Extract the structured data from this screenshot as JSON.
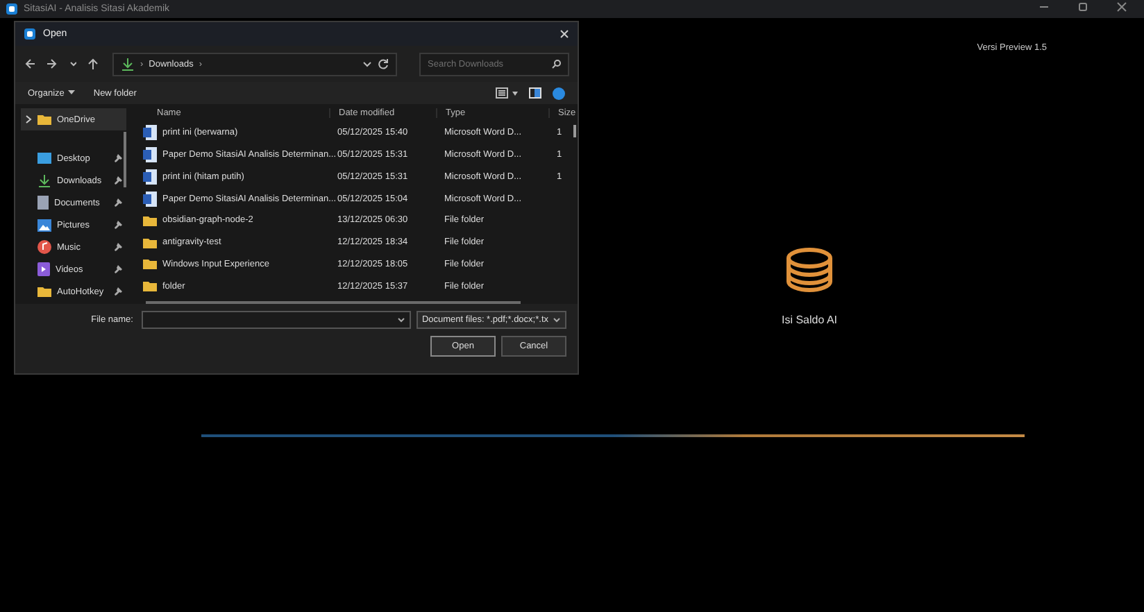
{
  "app": {
    "title": "SitasiAI - Analisis Sitasi Akademik",
    "version": "Versi Preview 1.5",
    "action_label": "Isi Saldo AI"
  },
  "dialog": {
    "title": "Open",
    "address": {
      "path": [
        "Downloads"
      ],
      "separator": "›"
    },
    "search": {
      "placeholder": "Search Downloads"
    },
    "toolbar": {
      "organize": "Organize",
      "new_folder": "New folder"
    },
    "sidebar": [
      {
        "label": "OneDrive",
        "kind": "folder",
        "selected": true,
        "pinned": false,
        "expandable": true
      },
      {
        "label": "Desktop",
        "kind": "desktop",
        "selected": false,
        "pinned": true,
        "expandable": false
      },
      {
        "label": "Downloads",
        "kind": "download",
        "selected": false,
        "pinned": true,
        "expandable": false
      },
      {
        "label": "Documents",
        "kind": "documents",
        "selected": false,
        "pinned": true,
        "expandable": false
      },
      {
        "label": "Pictures",
        "kind": "pictures",
        "selected": false,
        "pinned": true,
        "expandable": false
      },
      {
        "label": "Music",
        "kind": "music",
        "selected": false,
        "pinned": true,
        "expandable": false
      },
      {
        "label": "Videos",
        "kind": "videos",
        "selected": false,
        "pinned": true,
        "expandable": false
      },
      {
        "label": "AutoHotkey",
        "kind": "folder",
        "selected": false,
        "pinned": true,
        "expandable": false
      }
    ],
    "columns": [
      "Name",
      "Date modified",
      "Type",
      "Size"
    ],
    "rows": [
      {
        "kind": "word",
        "name": "print ini (berwarna)",
        "date": "05/12/2025 15:40",
        "type": "Microsoft Word D...",
        "size": "1",
        "selected": false
      },
      {
        "kind": "word",
        "name": "Paper Demo SitasiAI Analisis Determinan...",
        "date": "05/12/2025 15:31",
        "type": "Microsoft Word D...",
        "size": "1",
        "selected": false
      },
      {
        "kind": "word",
        "name": "print ini (hitam putih)",
        "date": "05/12/2025 15:31",
        "type": "Microsoft Word D...",
        "size": "1",
        "selected": false
      },
      {
        "kind": "word",
        "name": "Paper Demo SitasiAI Analisis Determinan...",
        "date": "05/12/2025 15:04",
        "type": "Microsoft Word D...",
        "size": "",
        "selected": false
      },
      {
        "kind": "folder",
        "name": "obsidian-graph-node-2",
        "date": "13/12/2025 06:30",
        "type": "File folder",
        "size": "",
        "selected": false
      },
      {
        "kind": "folder",
        "name": "antigravity-test",
        "date": "12/12/2025 18:34",
        "type": "File folder",
        "size": "",
        "selected": false
      },
      {
        "kind": "folder",
        "name": "Windows Input Experience",
        "date": "12/12/2025 18:05",
        "type": "File folder",
        "size": "",
        "selected": false
      },
      {
        "kind": "folder",
        "name": "folder",
        "date": "12/12/2025 15:37",
        "type": "File folder",
        "size": "",
        "selected": false
      }
    ],
    "file_name_label": "File name:",
    "filter": "Document files: *.pdf;*.docx;*.tx",
    "buttons": [
      "Open",
      "Cancel"
    ]
  }
}
